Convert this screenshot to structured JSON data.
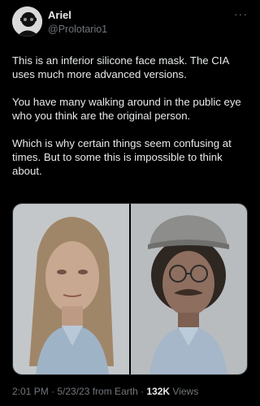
{
  "user": {
    "display_name": "Ariel",
    "handle": "@Prolotario1",
    "avatar_icon": "avatar-icon",
    "more_icon": "more-icon"
  },
  "tweet": {
    "paragraphs": [
      "This is an inferior silicone face mask. The CIA uses much more advanced versions.",
      "You have many walking around in the public eye who you think are the original person.",
      "Which is why certain things seem confusing at times. But to some this is impossible to think about."
    ]
  },
  "meta": {
    "timestamp": "2:01 PM · 5/23/23 from Earth · ",
    "views_count": "132K",
    "views_label": " Views"
  },
  "colors": {
    "background": "#000000",
    "text": "#e7e9ea",
    "secondary": "#71767b"
  }
}
